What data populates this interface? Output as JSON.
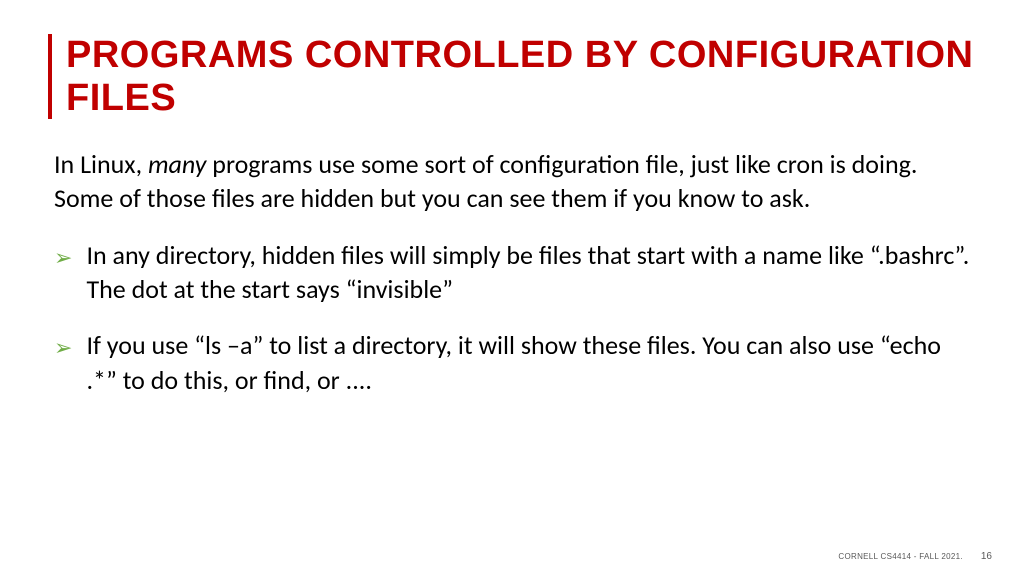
{
  "title": "PROGRAMS CONTROLLED BY CONFIGURATION FILES",
  "intro_pre": "In Linux, ",
  "intro_em": "many",
  "intro_post": " programs use some sort of configuration file, just like cron is doing.  Some of those files are hidden but you can see them if you know to ask.",
  "bullets": [
    "In any directory, hidden files will simply be files that start with a name like “.bashrc”.  The dot at the start says “invisible”",
    "If you use “ls –a” to list a directory, it will show these files.  You can also use “echo .*” to do this, or find, or ...."
  ],
  "footer": "CORNELL CS4414 - FALL 2021.",
  "page": "16"
}
